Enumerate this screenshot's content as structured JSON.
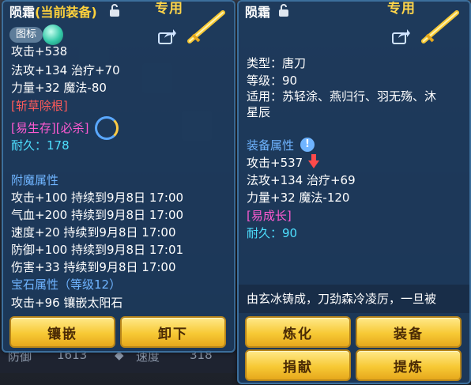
{
  "left": {
    "name": "陨霜",
    "equipped_tag": "(当前装备)",
    "special_tag": "专用",
    "badge_label": "图标",
    "lines": [
      "攻击+538",
      "法攻+134 治疗+70",
      "力量+32 魔法-80",
      "[斩草除根]",
      "易生存",
      "[必杀]",
      "耐久：178",
      "附魔属性",
      "攻击+100 持续到9月8日 17:00",
      "气血+200 持续到9月8日 17:00",
      "速度+20 持续到9月8日 17:00",
      "防御+100 持续到9月8日 17:01",
      "伤害+33 持续到9月8日 17:00",
      "宝石属性（等级12）",
      "攻击+96 镶嵌太阳石"
    ],
    "buttons": [
      "镶嵌",
      "卸下"
    ]
  },
  "background": {
    "stat_left_label": "防御",
    "stat_left_value": "1613",
    "stat_right_label": "速度",
    "stat_right_value": "318"
  },
  "right": {
    "name": "陨霜",
    "special_tag": "专用",
    "type_line": "类型：唐刀",
    "level_line": "等级：90",
    "fit_line1": "适用：苏轻涂、燕归行、羽无殇、沐",
    "fit_line2": "星辰",
    "equip_attr_title": "装备属性",
    "attr_lines": [
      "攻击+537",
      "法攻+134 治疗+69",
      "力量+32 魔法-120",
      "[易成长]",
      "耐久：90"
    ],
    "desc": "由玄冰铸成，刀劲森冷凌厉，一旦被",
    "buttons": [
      "炼化",
      "装备",
      "捐献",
      "提炼"
    ]
  },
  "colors": {
    "panel_bg": "#1c3a5c",
    "gold_button": "#f7c935",
    "section_blue": "#6fb4ff",
    "magenta": "#ff5ad2",
    "red": "#ff5a5a",
    "cyan": "#4ee0ff"
  }
}
